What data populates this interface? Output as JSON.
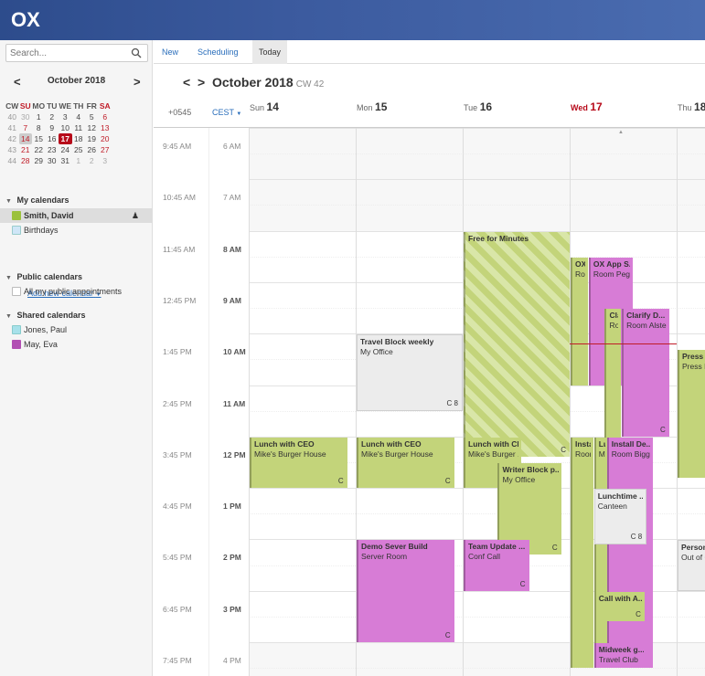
{
  "app": {
    "logo": "OX"
  },
  "search": {
    "placeholder": "Search..."
  },
  "mini": {
    "title": "October 2018",
    "prev": "<",
    "next": ">",
    "headers": [
      "CW",
      "SU",
      "MO",
      "TU",
      "WE",
      "TH",
      "FR",
      "SA"
    ],
    "weeks": [
      [
        "40",
        "30",
        "1",
        "2",
        "3",
        "4",
        "5",
        "6"
      ],
      [
        "41",
        "7",
        "8",
        "9",
        "10",
        "11",
        "12",
        "13"
      ],
      [
        "42",
        "14",
        "15",
        "16",
        "17",
        "18",
        "19",
        "20"
      ],
      [
        "43",
        "21",
        "22",
        "23",
        "24",
        "25",
        "26",
        "27"
      ],
      [
        "44",
        "28",
        "29",
        "30",
        "31",
        "1",
        "2",
        "3"
      ]
    ]
  },
  "sections": {
    "my": "My calendars",
    "public": "Public calendars",
    "shared": "Shared calendars"
  },
  "calendars": {
    "smith": "Smith, David",
    "birthdays": "Birthdays",
    "public_all": "All my public appointments",
    "jones": "Jones, Paul",
    "may": "May, Eva",
    "add": "Add new calendar"
  },
  "toolbar": {
    "new": "New",
    "scheduling": "Scheduling",
    "today": "Today"
  },
  "header": {
    "prev": "<",
    "next": ">",
    "title": "October 2018",
    "cw": "CW 42",
    "tz_offset": "+0545",
    "tz_name": "CEST"
  },
  "days": [
    {
      "dow": "Sun",
      "num": "14"
    },
    {
      "dow": "Mon",
      "num": "15"
    },
    {
      "dow": "Tue",
      "num": "16"
    },
    {
      "dow": "Wed",
      "num": "17"
    },
    {
      "dow": "Thu",
      "num": "18"
    }
  ],
  "times": {
    "left": [
      "9:45 AM",
      "10:45 AM",
      "11:45 AM",
      "12:45 PM",
      "1:45 PM",
      "2:45 PM",
      "3:45 PM",
      "4:45 PM",
      "5:45 PM",
      "6:45 PM",
      "7:45 PM"
    ],
    "right": [
      "6 AM",
      "7 AM",
      "8 AM",
      "9 AM",
      "10 AM",
      "11 AM",
      "12 PM",
      "1 PM",
      "2 PM",
      "3 PM",
      "4 PM"
    ]
  },
  "appointments": [
    {
      "title": "Free for Minutes",
      "loc": ""
    },
    {
      "title": "Travel Block weekly",
      "loc": "My Office"
    },
    {
      "title": "Lunch with CEO",
      "loc": "Mike's Burger House"
    },
    {
      "title": "Lunch with CEO",
      "loc": "Mike's Burger House"
    },
    {
      "title": "Lunch with CEO",
      "loc": "Mike's Burger ..."
    },
    {
      "title": "Writer Block p...",
      "loc": "My Office"
    },
    {
      "title": "Demo Sever Build",
      "loc": "Server Room"
    },
    {
      "title": "Team Update ...",
      "loc": "Conf Call"
    },
    {
      "title": "OX A",
      "loc": "Roo"
    },
    {
      "title": "OX App S...",
      "loc": "Room Peg..."
    },
    {
      "title": "Cla",
      "loc": "Roo"
    },
    {
      "title": "Clarify D...",
      "loc": "Room Alster"
    },
    {
      "title": "Instal",
      "loc": "Room"
    },
    {
      "title": "Lu",
      "loc": "Mi"
    },
    {
      "title": "Install De...",
      "loc": "Room Bigge"
    },
    {
      "title": "Lunchtime ...",
      "loc": "Canteen"
    },
    {
      "title": "Call with A...",
      "loc": ""
    },
    {
      "title": "Midweek g...",
      "loc": "Travel Club"
    },
    {
      "title": "Press F",
      "loc": "Press F"
    },
    {
      "title": "Person",
      "loc": "Out of O"
    }
  ],
  "icons": {
    "recurrence": "recurrence-icon",
    "private": "lock-icon"
  },
  "colors": {
    "green": "#c3d47a",
    "pink": "#d77cd6",
    "today": "#b70a1a",
    "link": "#2a6ebb"
  }
}
